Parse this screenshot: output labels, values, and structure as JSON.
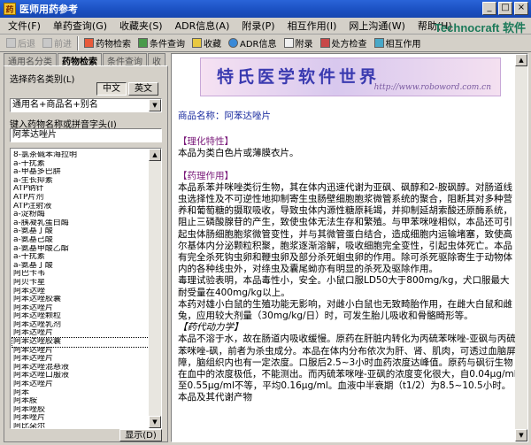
{
  "window": {
    "title": "医师用药参考",
    "controls": [
      "_",
      "□",
      "×"
    ]
  },
  "menu": [
    "文件(F)",
    "单药查询(G)",
    "收藏夹(S)",
    "ADR信息(A)",
    "附录(P)",
    "相互作用(I)",
    "网上沟通(W)",
    "帮助(H)"
  ],
  "brand": "Technocraft 软件",
  "toolbar": [
    {
      "label": "后退",
      "enabled": false,
      "icon": "back-arrow-icon"
    },
    {
      "label": "前进",
      "enabled": false,
      "icon": "forward-arrow-icon"
    },
    {
      "label": "药物检索",
      "enabled": true,
      "icon": "pill-icon"
    },
    {
      "label": "条件查询",
      "enabled": true,
      "icon": "search-conditions-icon"
    },
    {
      "label": "收藏",
      "enabled": true,
      "icon": "favorites-icon"
    },
    {
      "label": "ADR信息",
      "enabled": true,
      "icon": "adr-icon"
    },
    {
      "label": "附录",
      "enabled": true,
      "icon": "appendix-icon"
    },
    {
      "label": "处方检查",
      "enabled": true,
      "icon": "prescription-check-icon"
    },
    {
      "label": "相互作用",
      "enabled": true,
      "icon": "interaction-icon"
    }
  ],
  "tabs": [
    "通用名分类",
    "药物检索",
    "条件查询",
    "收"
  ],
  "search": {
    "lang_label": "选择药名类别(L)",
    "btn_cn": "中文",
    "btn_en": "英文",
    "category": "通用名+商品名+别名",
    "input_label": "键入药物名称或拼音字头(I)",
    "input_value": "阿苯达唑片",
    "show_button": "显示(D)"
  },
  "drug_list": [
    "8-氯茶碱苯海拉明",
    "a-干扰素",
    "a-甲基多巴肼",
    "a-生长抑素",
    "ATP钠针",
    "ATP片剂",
    "ATP注射液",
    "a-淀粉酶",
    "a-胰凝乳蛋白酶",
    "a-氨基丁酸",
    "a-氨基己酸",
    "a-氨基甲酸乙酯",
    "a-干扰素",
    "a-氨基丁酸",
    "阿巴卡韦",
    "阿贝卡星",
    "阿苯达唑",
    "阿苯达唑胶囊",
    "阿苯达唑片",
    "阿苯达唑颗粒",
    "阿苯达唑乳剂",
    "阿苯达唑片",
    "阿苯达唑胶囊",
    "阿苯达唑片",
    "阿苯达唑片",
    "阿苯达唑混悬液",
    "阿苯达唑口服液",
    "阿苯达唑片",
    "阿苯",
    "阿苯胺",
    "阿苯唑胶",
    "阿苯唑片",
    "阿比朵尔",
    "阿比多尔",
    "阿比特龙",
    "阿昔洛韦",
    "阿布他明"
  ],
  "document": {
    "banner_title": "特氏医学软件世界",
    "banner_url": "http://www.roboword.com.cn",
    "drug_label": "商品名称：阿苯达唑片",
    "sec1_title": "【理化特性】",
    "sec1_body": "本品为类白色片或薄膜衣片。",
    "sec2_title": "【药理作用】",
    "sec2_p1": "本品系苯并咪唑类衍生物，其在体内迅速代谢为亚砜、砜醇和2-胺砜醇。对肠道线虫选择性及不可逆性地抑制寄生虫肠壁细胞胞浆微管系统的聚合，阻断其对多种营养和葡萄糖的摄取吸收，导致虫体内源性糖原耗竭，并抑制延胡索酸还原酶系统，阻止三磷酸腺苷的产生，致使虫体无法生存和繁殖。与甲苯咪唑相似，本品还可引起虫体肠细胞胞浆微管变性，并与其微管蛋白结合，造成细胞内运输堵塞，致使高尔基体内分泌颗粒积聚，胞浆逐渐溶解，吸收细胞完全变性，引起虫体死亡。本品有完全杀死钩虫卵和鞭虫卵及部分杀死蛔虫卵的作用。除可杀死驱除寄生于动物体内的各种线虫外，对绦虫及囊尾蚴亦有明显的杀死及驱除作用。",
    "sec2_p2": "毒理试验表明，本品毒性小，安全。小鼠口服LD50大于800mg/kg，犬口服最大耐受量在400mg/kg以上。",
    "sec2_p3": "本药对雄小白鼠的生殖功能无影响，对雌小白鼠也无致畸胎作用，在雌大白鼠和雌兔，应用较大剂量（30mg/kg/日）时，可发生胎儿吸收和骨骼畸形等。",
    "sec3_title": "【药代动力学】",
    "sec3_body": "本品不溶于水，故在肠道内吸收缓慢。原药在肝脏内转化为丙硫苯咪唑-亚砜与丙硫苯咪唑-砜，前者为杀虫成分。本品在体内分布依次为肝、肾、肌肉，可透过血脑屏障，脑组织内也有一定浓度。口服后2.5~3小时血药浓度达峰值。原药与砜衍生物在血中的浓度极低，不能测出。而丙硫苯咪唑-亚砜的浓度变化很大，自0.04μg/ml至0.55μg/ml不等，平均0.16μg/ml。血液中半衰期（t1/2）为8.5~10.5小时。本品及其代谢产物"
  }
}
